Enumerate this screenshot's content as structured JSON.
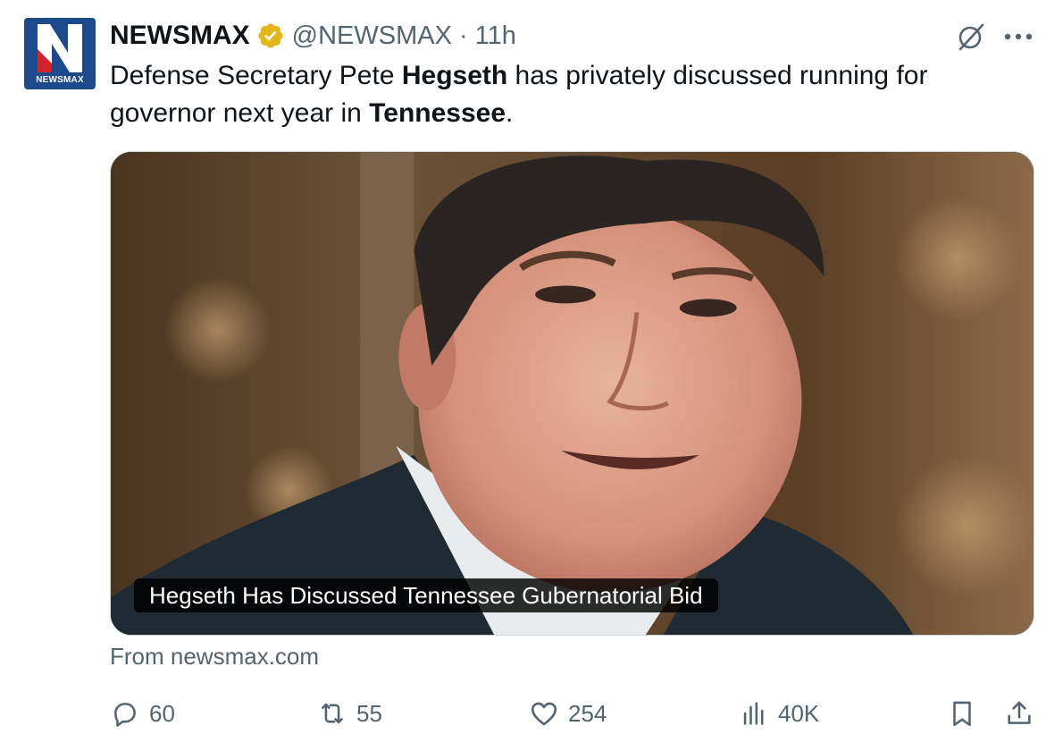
{
  "account": {
    "display_name": "NEWSMAX",
    "handle": "@NEWSMAX",
    "separator": "·",
    "time": "11h",
    "avatar_label": "NEWSMAX",
    "avatar_icon": "newsmax-logo",
    "verified_icon": "gold-verified-badge",
    "brand_color": "#1d4a8c",
    "verified_color": "#e2b719"
  },
  "post": {
    "text_parts": [
      "Defense Secretary Pete ",
      "Hegseth",
      " has privately discussed running for governor next year in ",
      "Tennessee",
      "."
    ]
  },
  "card": {
    "caption": "Hegseth Has Discussed Tennessee Gubernatorial Bid",
    "source": "From newsmax.com"
  },
  "actions": {
    "replies": "60",
    "reposts": "55",
    "likes": "254",
    "views": "40K"
  },
  "colors": {
    "text": "#0f1419",
    "secondary": "#536471"
  }
}
